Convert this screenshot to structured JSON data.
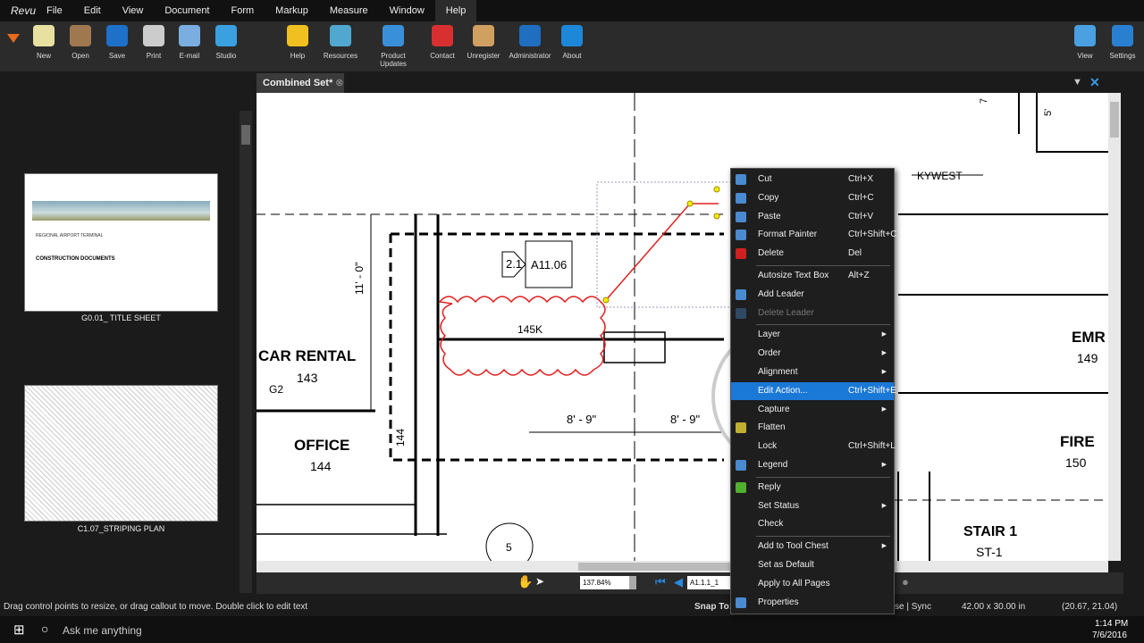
{
  "app": {
    "logo": "Revu"
  },
  "menu": [
    "File",
    "Edit",
    "View",
    "Document",
    "Form",
    "Markup",
    "Measure",
    "Window",
    "Help"
  ],
  "menu_active": "Help",
  "toolbar": [
    {
      "label": "New",
      "icon": "new-file-icon",
      "color": "#e8e0a0"
    },
    {
      "label": "Open",
      "icon": "folder-icon",
      "color": "#a07850"
    },
    {
      "label": "Save",
      "icon": "save-icon",
      "color": "#1e70c8"
    },
    {
      "label": "Print",
      "icon": "printer-icon",
      "color": "#ccc"
    },
    {
      "label": "E-mail",
      "icon": "email-icon",
      "color": "#7aaee0"
    },
    {
      "label": "Studio",
      "icon": "studio-icon",
      "color": "#3aa0e0"
    },
    {
      "label": "Help",
      "icon": "help-icon",
      "color": "#f0c020"
    },
    {
      "label": "Resources",
      "icon": "resources-icon",
      "color": "#50a8d0"
    },
    {
      "label": "Product Updates",
      "icon": "updates-icon",
      "color": "#3a90d8"
    },
    {
      "label": "Contact",
      "icon": "lifebuoy-icon",
      "color": "#d83030"
    },
    {
      "label": "Unregister",
      "icon": "key-icon",
      "color": "#d0a060"
    },
    {
      "label": "Administrator",
      "icon": "administrator-icon",
      "color": "#1f6ec0"
    },
    {
      "label": "About",
      "icon": "info-icon",
      "color": "#1e88d8"
    },
    {
      "label": "View",
      "icon": "monitor-icon",
      "color": "#4aa0e0"
    },
    {
      "label": "Settings",
      "icon": "settings-icon",
      "color": "#2a80d0"
    }
  ],
  "thumbnails": [
    {
      "caption": "G0.01_ TITLE SHEET",
      "title": "REGIONAL AIRPORT TERMINAL",
      "subtitle": "CONSTRUCTION DOCUMENTS"
    },
    {
      "caption": "C1.07_STRIPING PLAN"
    }
  ],
  "document_tab": "Combined Set*",
  "drawing": {
    "car_rental": "CAR RENTAL",
    "room_143": "143",
    "office": "OFFICE",
    "room_144": "144",
    "emr": "EMR",
    "room_149": "149",
    "fire": "FIRE",
    "room_150": "150",
    "stair": "STAIR 1",
    "stair_tag": "ST-1",
    "detail_ref": "A11.06",
    "detail_num": "2.1",
    "cloud_label": "145K",
    "dim1": "8' - 9\"",
    "dim2": "8' - 9\"",
    "dim_vert": "11' - 0\"",
    "wall_144": "144",
    "g2": "G2",
    "skywest": "KYWEST",
    "bubble_num": "5",
    "five": "5'",
    "seven": "7"
  },
  "context_menu": [
    {
      "label": "Cut",
      "shortcut": "Ctrl+X",
      "icon": "scissors-icon"
    },
    {
      "label": "Copy",
      "shortcut": "Ctrl+C",
      "icon": "copy-icon"
    },
    {
      "label": "Paste",
      "shortcut": "Ctrl+V",
      "icon": "paste-icon"
    },
    {
      "label": "Format Painter",
      "shortcut": "Ctrl+Shift+C",
      "icon": "format-painter-icon"
    },
    {
      "label": "Delete",
      "shortcut": "Del",
      "icon": "delete-icon"
    },
    {
      "sep": true
    },
    {
      "label": "Autosize Text Box",
      "shortcut": "Alt+Z"
    },
    {
      "label": "Add Leader",
      "icon": "leader-icon"
    },
    {
      "label": "Delete Leader",
      "disabled": true,
      "icon": "delete-leader-icon"
    },
    {
      "sep": true
    },
    {
      "label": "Layer",
      "submenu": true
    },
    {
      "label": "Order",
      "submenu": true
    },
    {
      "label": "Alignment",
      "submenu": true
    },
    {
      "label": "Edit Action...",
      "shortcut": "Ctrl+Shift+E",
      "highlight": true
    },
    {
      "label": "Capture",
      "submenu": true
    },
    {
      "label": "Flatten",
      "icon": "flatten-icon"
    },
    {
      "label": "Lock",
      "shortcut": "Ctrl+Shift+L"
    },
    {
      "label": "Legend",
      "submenu": true,
      "icon": "legend-icon"
    },
    {
      "sep": true
    },
    {
      "label": "Reply",
      "icon": "reply-icon"
    },
    {
      "label": "Set Status",
      "submenu": true
    },
    {
      "label": "Check"
    },
    {
      "sep": true
    },
    {
      "label": "Add to Tool Chest",
      "submenu": true
    },
    {
      "label": "Set as Default"
    },
    {
      "label": "Apply to All Pages"
    },
    {
      "label": "Properties",
      "icon": "gear-icon"
    }
  ],
  "navbar": {
    "zoom": "137.84%",
    "page": "A1.1.1_1"
  },
  "status": {
    "hint": "Drag control points to resize, or drag callout to move. Double click to edit text",
    "snap": "Snap To:",
    "sync": "se | Sync",
    "size": "42.00 x 30.00 in",
    "coords": "(20.67, 21.04)"
  },
  "taskbar": {
    "search": "Ask me anything",
    "time": "1:14 PM",
    "date": "7/6/2016"
  },
  "colors": {
    "accent": "#1a78d6",
    "markup": "#e02020"
  }
}
